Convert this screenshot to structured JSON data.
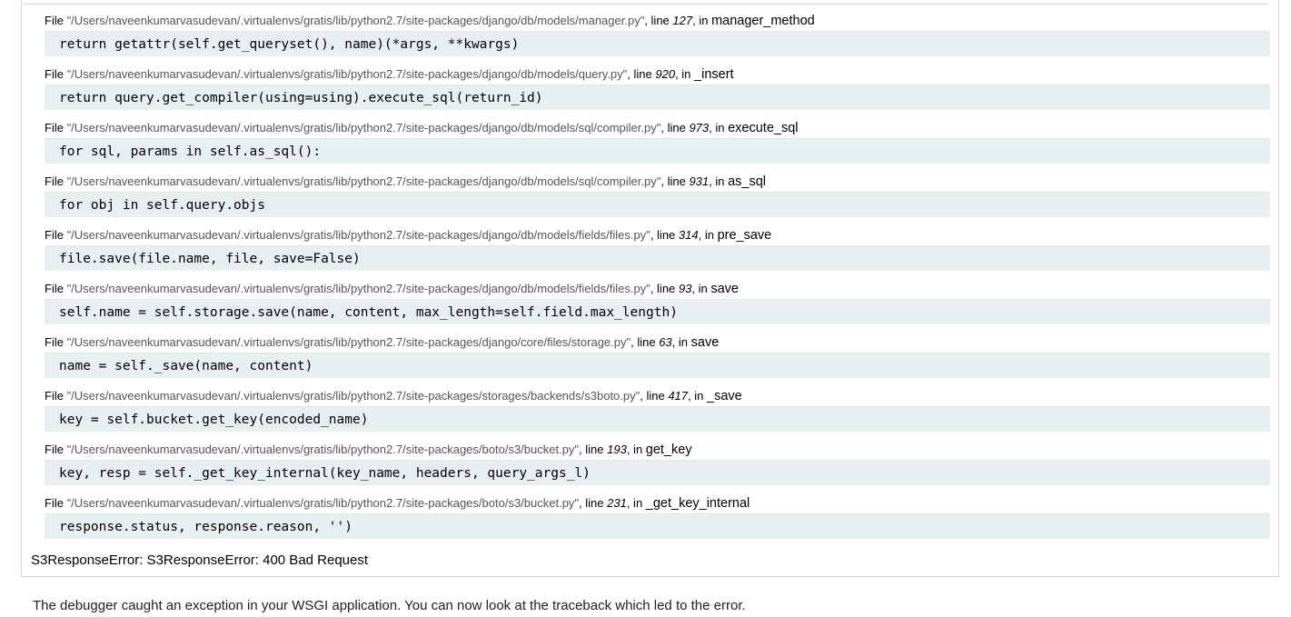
{
  "traceback": {
    "frames": [
      {
        "file_prefix": "File ",
        "filename": "\"/Users/naveenkumarvasudevan/.virtualenvs/gratis/lib/python2.7/site-packages/django/db/models/manager.py\"",
        "line_prefix": ", line ",
        "lineno": "127",
        "in_prefix": ", in ",
        "function": "manager_method",
        "source": "return getattr(self.get_queryset(), name)(*args, **kwargs)"
      },
      {
        "file_prefix": "File ",
        "filename": "\"/Users/naveenkumarvasudevan/.virtualenvs/gratis/lib/python2.7/site-packages/django/db/models/query.py\"",
        "line_prefix": ", line ",
        "lineno": "920",
        "in_prefix": ", in ",
        "function": "_insert",
        "source": "return query.get_compiler(using=using).execute_sql(return_id)"
      },
      {
        "file_prefix": "File ",
        "filename": "\"/Users/naveenkumarvasudevan/.virtualenvs/gratis/lib/python2.7/site-packages/django/db/models/sql/compiler.py\"",
        "line_prefix": ", line ",
        "lineno": "973",
        "in_prefix": ", in ",
        "function": "execute_sql",
        "source": "for sql, params in self.as_sql():"
      },
      {
        "file_prefix": "File ",
        "filename": "\"/Users/naveenkumarvasudevan/.virtualenvs/gratis/lib/python2.7/site-packages/django/db/models/sql/compiler.py\"",
        "line_prefix": ", line ",
        "lineno": "931",
        "in_prefix": ", in ",
        "function": "as_sql",
        "source": "for obj in self.query.objs"
      },
      {
        "file_prefix": "File ",
        "filename": "\"/Users/naveenkumarvasudevan/.virtualenvs/gratis/lib/python2.7/site-packages/django/db/models/fields/files.py\"",
        "line_prefix": ", line ",
        "lineno": "314",
        "in_prefix": ", in ",
        "function": "pre_save",
        "source": "file.save(file.name, file, save=False)"
      },
      {
        "file_prefix": "File ",
        "filename": "\"/Users/naveenkumarvasudevan/.virtualenvs/gratis/lib/python2.7/site-packages/django/db/models/fields/files.py\"",
        "line_prefix": ", line ",
        "lineno": "93",
        "in_prefix": ", in ",
        "function": "save",
        "source": "self.name = self.storage.save(name, content, max_length=self.field.max_length)"
      },
      {
        "file_prefix": "File ",
        "filename": "\"/Users/naveenkumarvasudevan/.virtualenvs/gratis/lib/python2.7/site-packages/django/core/files/storage.py\"",
        "line_prefix": ", line ",
        "lineno": "63",
        "in_prefix": ", in ",
        "function": "save",
        "source": "name = self._save(name, content)"
      },
      {
        "file_prefix": "File ",
        "filename": "\"/Users/naveenkumarvasudevan/.virtualenvs/gratis/lib/python2.7/site-packages/storages/backends/s3boto.py\"",
        "line_prefix": ", line ",
        "lineno": "417",
        "in_prefix": ", in ",
        "function": "_save",
        "source": "key = self.bucket.get_key(encoded_name)"
      },
      {
        "file_prefix": "File ",
        "filename": "\"/Users/naveenkumarvasudevan/.virtualenvs/gratis/lib/python2.7/site-packages/boto/s3/bucket.py\"",
        "line_prefix": ", line ",
        "lineno": "193",
        "in_prefix": ", in ",
        "function": "get_key",
        "source": "key, resp = self._get_key_internal(key_name, headers, query_args_l)"
      },
      {
        "file_prefix": "File ",
        "filename": "\"/Users/naveenkumarvasudevan/.virtualenvs/gratis/lib/python2.7/site-packages/boto/s3/bucket.py\"",
        "line_prefix": ", line ",
        "lineno": "231",
        "in_prefix": ", in ",
        "function": "_get_key_internal",
        "source": "response.status, response.reason, '')"
      }
    ],
    "error_message": "S3ResponseError: S3ResponseError: 400 Bad Request"
  },
  "explanation": "The debugger caught an exception in your WSGI application. You can now look at the traceback which led to the error.",
  "colors": {
    "source_background": "#e8eff0",
    "filename_text": "#555555",
    "border": "#d6d6d6"
  }
}
